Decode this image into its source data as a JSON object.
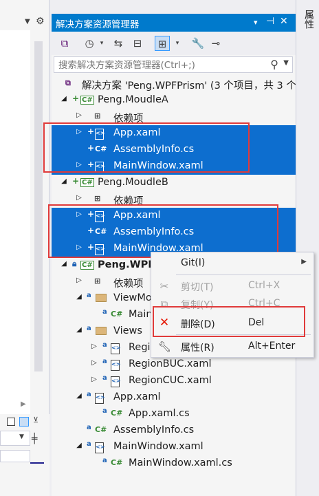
{
  "panel": {
    "title": "解决方案资源管理器",
    "title_buttons": [
      "▾",
      "⊣",
      "✕"
    ],
    "search_placeholder": "搜索解决方案资源管理器(Ctrl+;)"
  },
  "right_tab": {
    "label": "属性"
  },
  "tree": {
    "solution_label": "解决方案 'Peng.WPFPrism' (3 个项目，共 3 个",
    "projects": [
      {
        "name": "Peng.MoudleA",
        "items": [
          "依赖项",
          "App.xaml",
          "AssemblyInfo.cs",
          "MainWindow.xaml"
        ]
      },
      {
        "name": "Peng.MoudleB",
        "items": [
          "依赖项",
          "App.xaml",
          "AssemblyInfo.cs",
          "MainWindow.xaml"
        ]
      },
      {
        "name": "Peng.WPF",
        "items": [
          "依赖项",
          "ViewMo",
          "Main",
          "Views",
          "Regio",
          "RegionBUC.xaml",
          "RegionCUC.xaml",
          "App.xaml",
          "App.xaml.cs",
          "AssemblyInfo.cs",
          "MainWindow.xaml",
          "MainWindow.xaml.cs"
        ]
      }
    ]
  },
  "context_menu": {
    "items": [
      {
        "label": "Git(I)",
        "shortcut": "",
        "enabled": true
      },
      {
        "label": "剪切(T)",
        "shortcut": "Ctrl+X",
        "enabled": false
      },
      {
        "label": "复制(Y)",
        "shortcut": "Ctrl+C",
        "enabled": false
      },
      {
        "label": "删除(D)",
        "shortcut": "Del",
        "enabled": true
      },
      {
        "label": "属性(R)",
        "shortcut": "Alt+Enter",
        "enabled": true
      }
    ]
  },
  "colors": {
    "accent": "#007acc",
    "selection": "#0d6ecf",
    "highlight_box": "#e03a3a",
    "delete_icon": "#e51400"
  }
}
